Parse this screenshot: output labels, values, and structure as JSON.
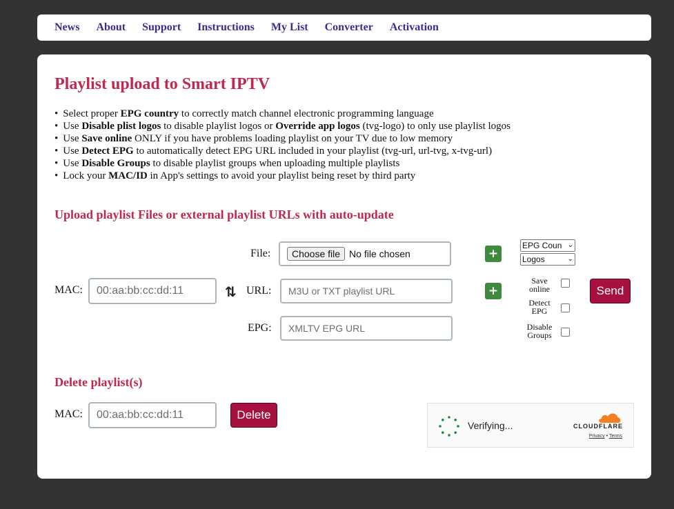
{
  "nav": {
    "items": [
      {
        "label": "News"
      },
      {
        "label": "About"
      },
      {
        "label": "Support"
      },
      {
        "label": "Instructions"
      },
      {
        "label": "My List"
      },
      {
        "label": "Converter"
      },
      {
        "label": "Activation"
      }
    ]
  },
  "main": {
    "title": "Playlist upload to Smart IPTV",
    "tips": [
      {
        "pre": "Select proper ",
        "b1": "EPG country",
        "mid": " to correctly match channel electronic programming language",
        "b2": "",
        "post": ""
      },
      {
        "pre": "Use ",
        "b1": "Disable plist logos",
        "mid": " to disable playlist logos or ",
        "b2": "Override app logos",
        "post": " (tvg-logo) to only use playlist logos"
      },
      {
        "pre": "Use ",
        "b1": "Save online",
        "mid": " ONLY if you have problems loading playlist on your TV due to low memory",
        "b2": "",
        "post": ""
      },
      {
        "pre": "Use ",
        "b1": "Detect EPG",
        "mid": " to automatically detect EPG URL included in your playlist (tvg-url, url-tvg, x-tvg-url)",
        "b2": "",
        "post": ""
      },
      {
        "pre": "Use ",
        "b1": "Disable Groups",
        "mid": " to disable playlist groups when uploading multiple playlists",
        "b2": "",
        "post": ""
      },
      {
        "pre": "Lock your ",
        "b1": "MAC/ID",
        "mid": " in App's settings to avoid your playlist being reset by third party",
        "b2": "",
        "post": ""
      }
    ]
  },
  "upload": {
    "heading": "Upload playlist Files or external playlist URLs with auto-update",
    "mac_label": "MAC:",
    "mac_placeholder": "00:aa:bb:cc:dd:11",
    "file_label": "File:",
    "choose_file": "Choose file",
    "no_file": "No file chosen",
    "url_label": "URL:",
    "url_placeholder": "M3U or TXT playlist URL",
    "epg_label": "EPG:",
    "epg_placeholder": "XMLTV EPG URL",
    "plus_symbol": "+",
    "swap_symbol": "⇅",
    "epg_country_select": "EPG Coun",
    "logos_select": "Logos",
    "select_caret": "⌄",
    "save_online": "Save online",
    "detect_epg": "Detect EPG",
    "disable_groups": "Disable Groups",
    "send": "Send"
  },
  "delete": {
    "heading": "Delete playlist(s)",
    "mac_label": "MAC:",
    "mac_placeholder": "00:aa:bb:cc:dd:11",
    "button": "Delete"
  },
  "captcha": {
    "status": "Verifying...",
    "brand": "CLOUDFLARE",
    "privacy": "Privacy",
    "separator": "•",
    "terms": "Terms"
  },
  "colors": {
    "page_bg": "#333333",
    "nav_link": "#3a2d8f",
    "heading": "#c0284f",
    "button": "#a7103f",
    "plus": "#3f8a3f",
    "cloudflare_orange": "#f38020"
  }
}
